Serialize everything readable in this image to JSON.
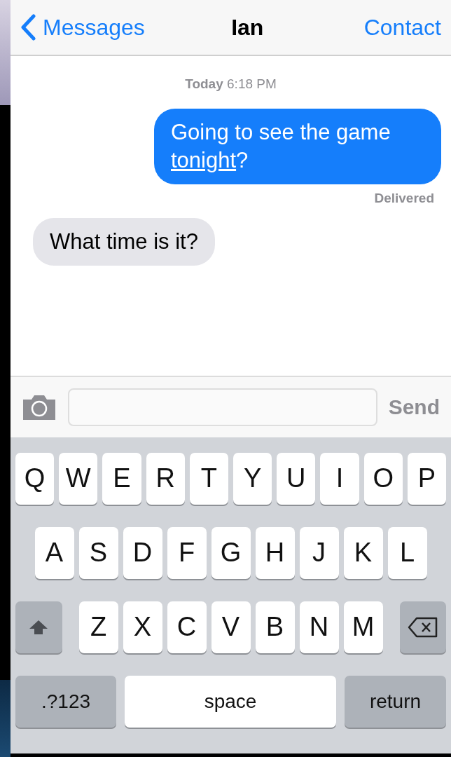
{
  "nav": {
    "back": "Messages",
    "title": "Ian",
    "action": "Contact"
  },
  "timestamp": {
    "day": "Today",
    "time": "6:18 PM"
  },
  "messages": [
    {
      "kind": "sent",
      "parts": [
        {
          "text": "Going to see the game "
        },
        {
          "text": "tonight",
          "link": true
        },
        {
          "text": "?"
        }
      ],
      "status": "Delivered"
    },
    {
      "kind": "received",
      "parts": [
        {
          "text": "What time is it?"
        }
      ]
    }
  ],
  "composer": {
    "send": "Send",
    "disabled": true
  },
  "keyboard": {
    "top_row": [
      {
        "kind": "letter",
        "label": "Q"
      },
      {
        "kind": "letter",
        "label": "W"
      },
      {
        "kind": "letter",
        "label": "E"
      },
      {
        "kind": "letter",
        "label": "R"
      },
      {
        "kind": "letter",
        "label": "T"
      },
      {
        "kind": "letter",
        "label": "Y"
      },
      {
        "kind": "letter",
        "label": "U"
      },
      {
        "kind": "letter",
        "label": "I"
      },
      {
        "kind": "letter",
        "label": "O"
      },
      {
        "kind": "letter",
        "label": "P"
      }
    ],
    "middle_row": [
      {
        "kind": "letter",
        "label": "A"
      },
      {
        "kind": "letter",
        "label": "S"
      },
      {
        "kind": "letter",
        "label": "D"
      },
      {
        "kind": "letter",
        "label": "F"
      },
      {
        "kind": "letter",
        "label": "G"
      },
      {
        "kind": "letter",
        "label": "H"
      },
      {
        "kind": "letter",
        "label": "J"
      },
      {
        "kind": "letter",
        "label": "K"
      },
      {
        "kind": "letter",
        "label": "L"
      }
    ],
    "lower_row": [
      {
        "kind": "shift"
      },
      {
        "kind": "letter",
        "label": "Z"
      },
      {
        "kind": "letter",
        "label": "X"
      },
      {
        "kind": "letter",
        "label": "C"
      },
      {
        "kind": "letter",
        "label": "V"
      },
      {
        "kind": "letter",
        "label": "B"
      },
      {
        "kind": "letter",
        "label": "N"
      },
      {
        "kind": "letter",
        "label": "M"
      },
      {
        "kind": "delete"
      }
    ],
    "bottom_row": [
      {
        "kind": "mode",
        "label": ".?123"
      },
      {
        "kind": "space",
        "label": "space"
      },
      {
        "kind": "return",
        "label": "return"
      }
    ]
  }
}
